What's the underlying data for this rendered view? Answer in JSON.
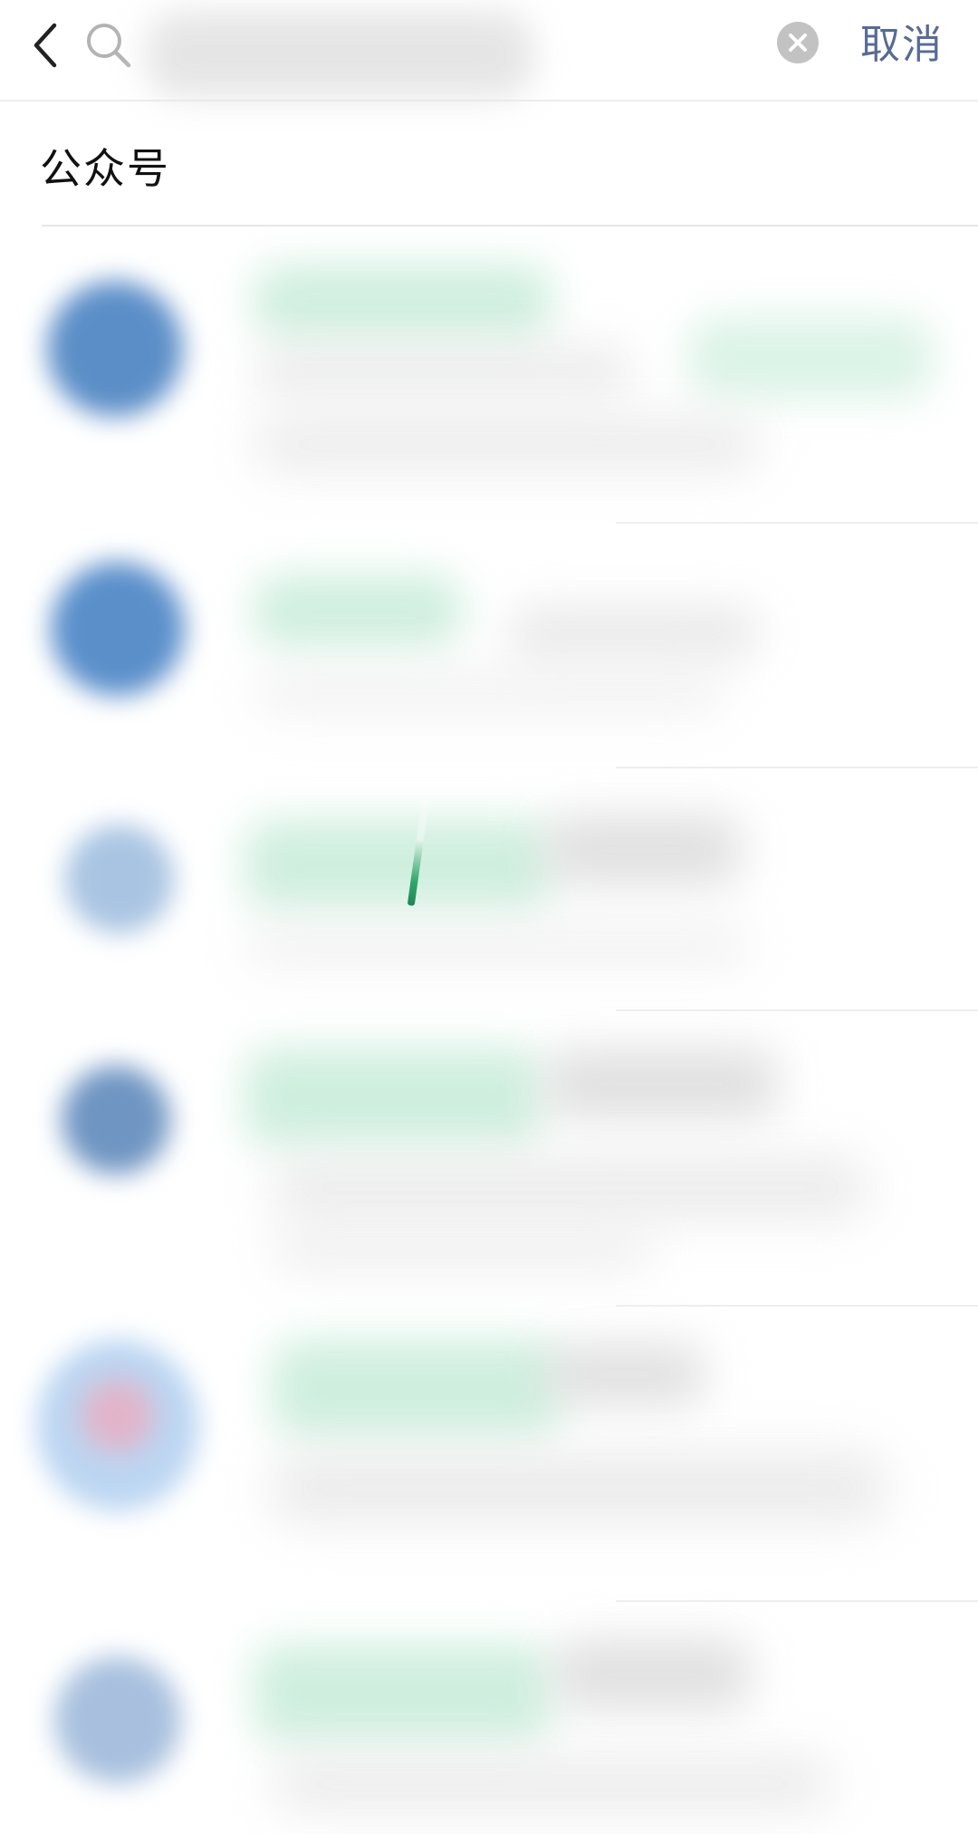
{
  "search": {
    "query": "",
    "placeholder": "",
    "cancel_label": "取消",
    "back_icon": "chevron-left-icon",
    "search_icon": "search-icon",
    "clear_icon": "clear-circle-icon"
  },
  "section": {
    "title": "公众号"
  },
  "results": [
    {
      "name": "",
      "description": ""
    },
    {
      "name": "",
      "description": ""
    },
    {
      "name": "",
      "description": ""
    },
    {
      "name": "",
      "description": ""
    },
    {
      "name": "",
      "description": ""
    },
    {
      "name": "",
      "description": ""
    }
  ],
  "colors": {
    "link": "#576b95",
    "divider": "#e6e6e6",
    "clear_button": "#c2c2c2",
    "blurred_name": "#cdeedd",
    "avatar_blue": "#5b8ec7"
  }
}
